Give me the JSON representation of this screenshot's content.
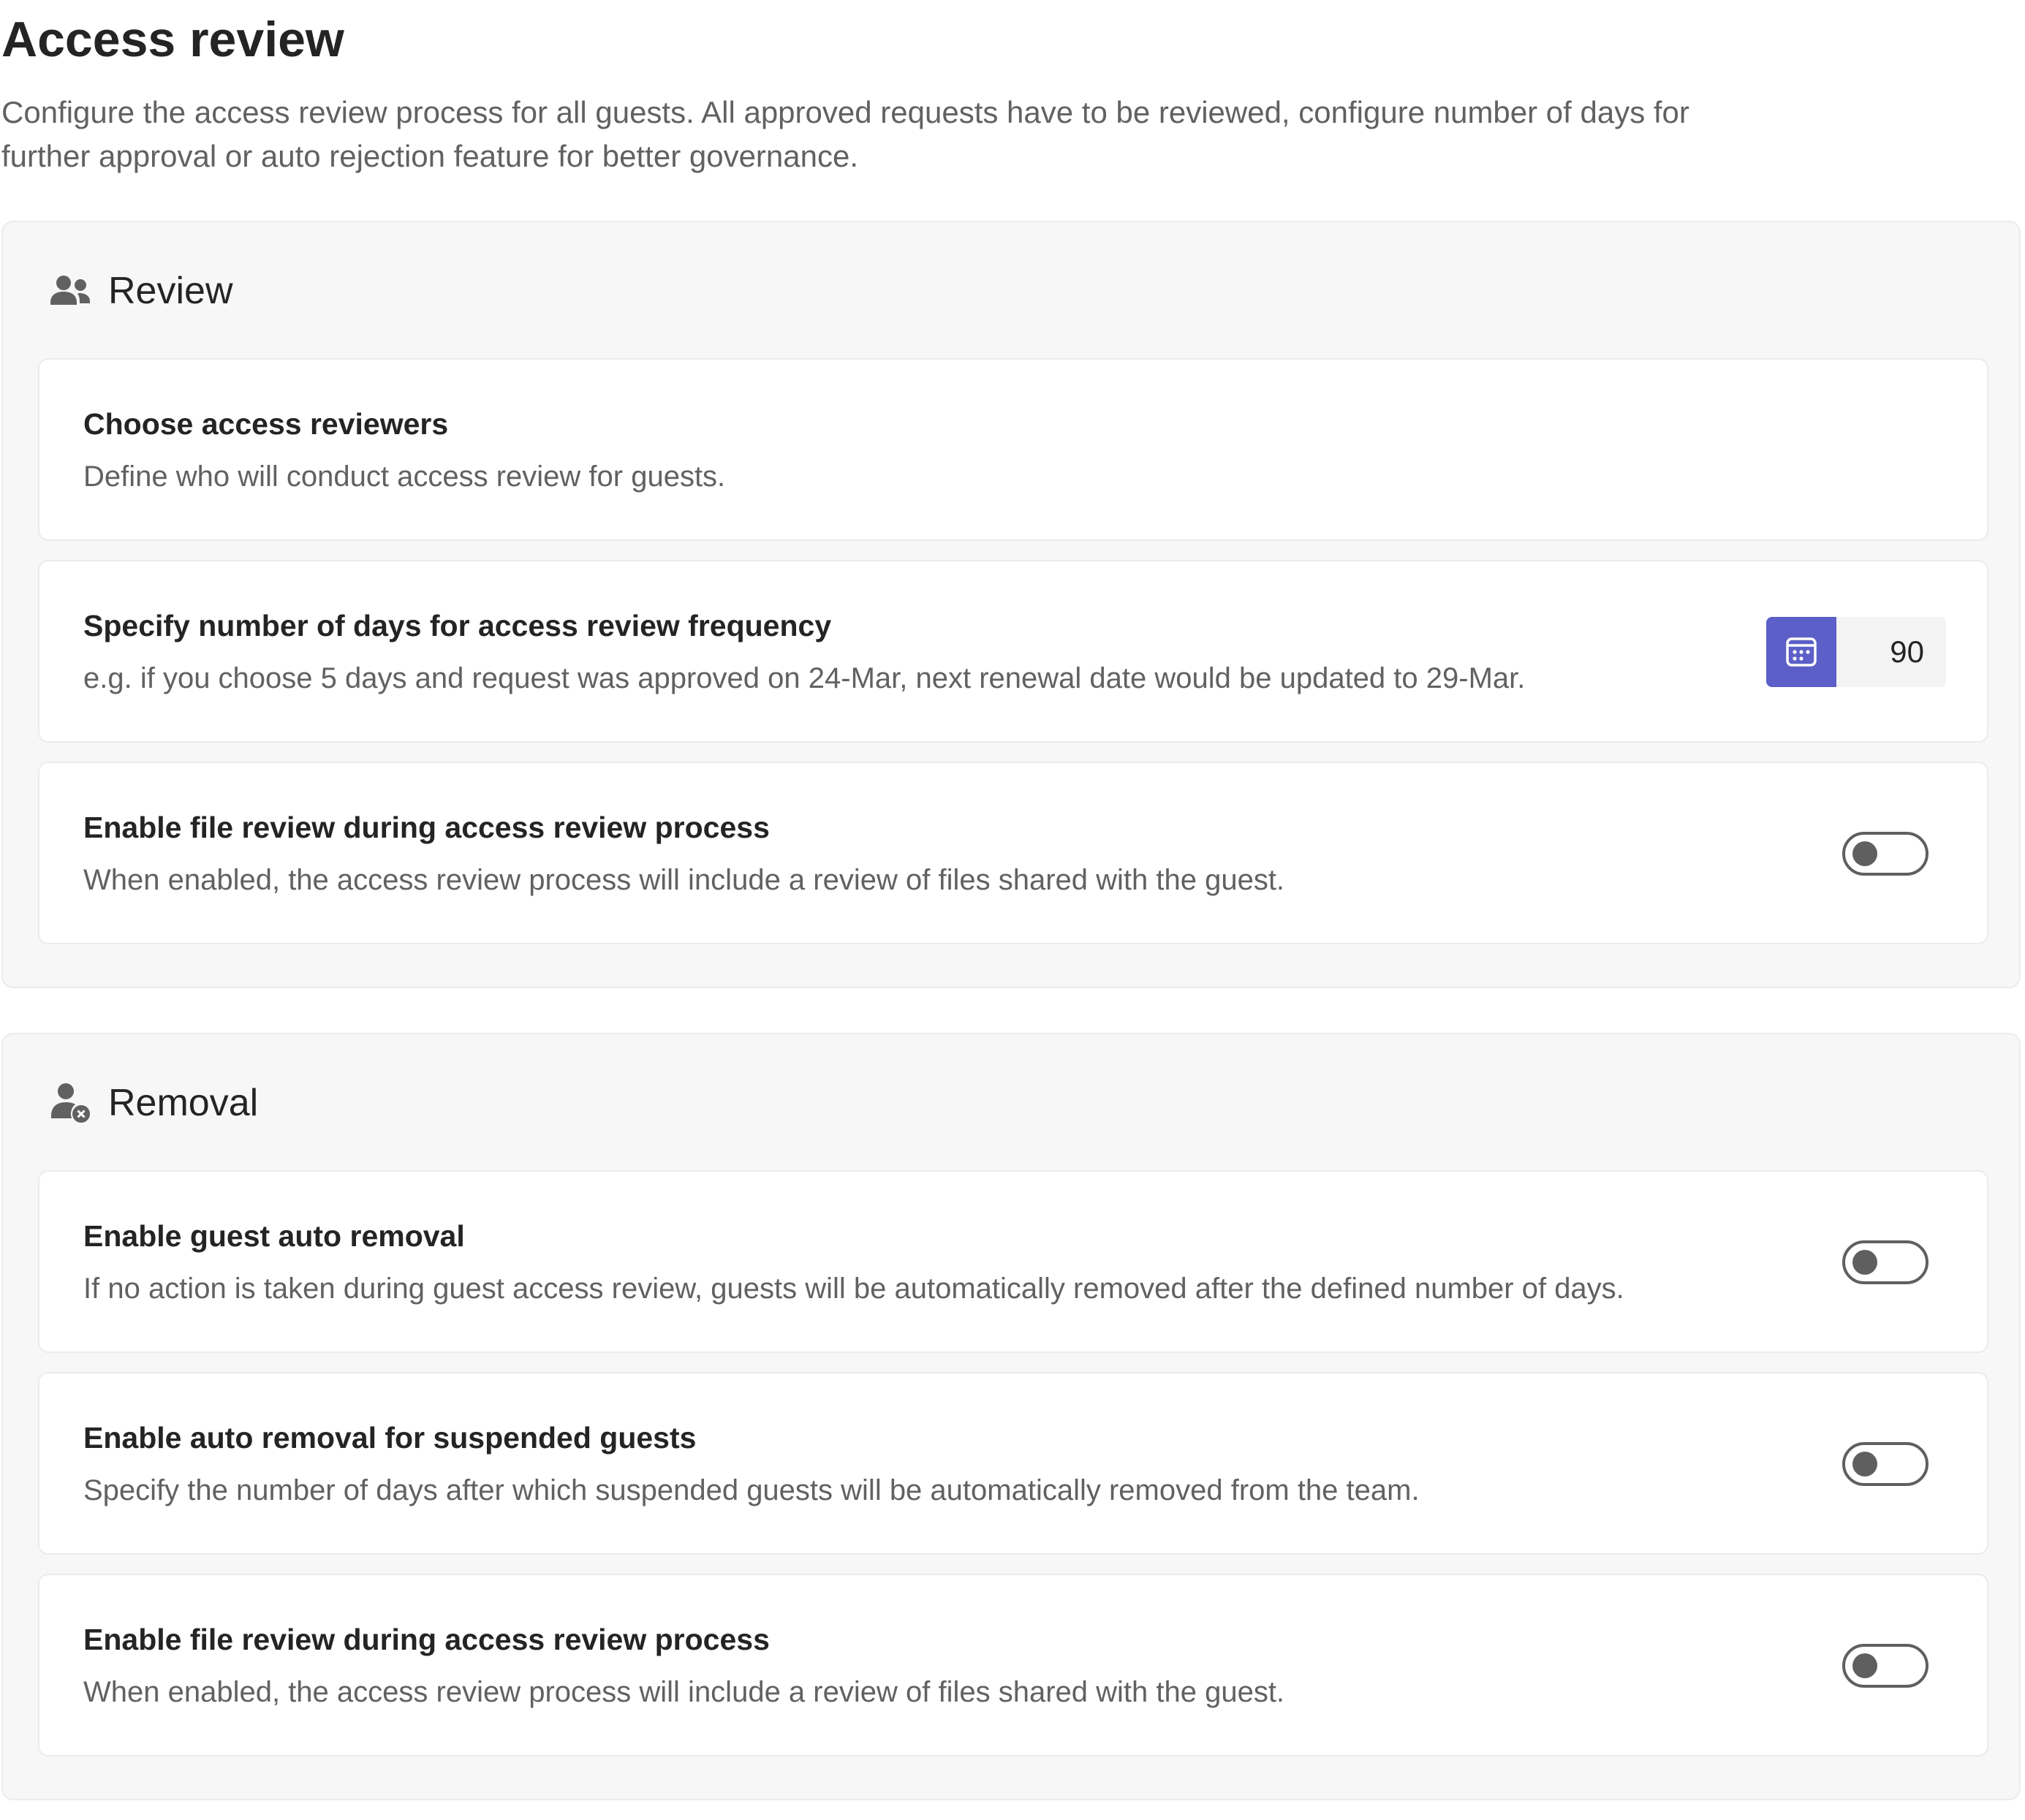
{
  "page": {
    "title": "Access review",
    "description": "Configure the access review process for all guests. All approved requests have to be reviewed, configure number of days for further approval or auto rejection feature for better governance."
  },
  "sections": {
    "review": {
      "title": "Review",
      "icon": "people-icon",
      "cards": [
        {
          "title": "Choose access reviewers",
          "description": "Define who will conduct access review for guests."
        },
        {
          "title": "Specify number of days for access review frequency",
          "description": "e.g. if you choose 5 days and request was approved on 24-Mar, next renewal date would be updated to 29-Mar.",
          "input_value": "90",
          "input_icon": "calendar-icon"
        },
        {
          "title": "Enable file review during access review process",
          "description": "When enabled, the access review process will include a review of files shared with the guest.",
          "toggle_on": false
        }
      ]
    },
    "removal": {
      "title": "Removal",
      "icon": "person-remove-icon",
      "cards": [
        {
          "title": "Enable guest auto removal",
          "description": "If no action is taken during guest access review, guests will be automatically removed after the defined number of days.",
          "toggle_on": false
        },
        {
          "title": "Enable auto removal for suspended guests",
          "description": "Specify the number of days after which suspended guests will be automatically removed from the team.",
          "toggle_on": false
        },
        {
          "title": "Enable file review during access review process",
          "description": "When enabled, the access review process will include a review of files shared with the guest.",
          "toggle_on": false
        }
      ]
    }
  },
  "colors": {
    "accent": "#5b5fc7",
    "section_bg": "#f7f7f8",
    "card_bg": "#ffffff",
    "toggle_off": "#5f5f5f"
  }
}
